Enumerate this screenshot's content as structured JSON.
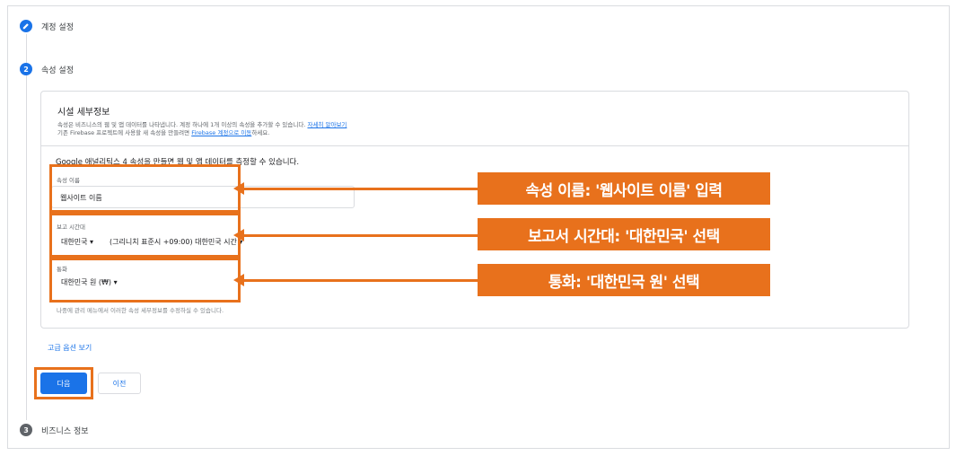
{
  "steps": [
    {
      "number": "",
      "label": "계정 설정",
      "icon": "pencil-icon"
    },
    {
      "number": "2",
      "label": "속성 설정"
    },
    {
      "number": "3",
      "label": "비즈니스 정보"
    }
  ],
  "card": {
    "title": "시설 세부정보",
    "sub1": "속성은 비즈니스의 웹 및 앱 데이터를 나타냅니다. 계정 하나에 1개 이상의 속성을 추가할 수 있습니다.",
    "sub1_link": "자세히 알아보기",
    "sub2_pre": "기존 Firebase 프로젝트에 사용할 새 속성을 만들려면 ",
    "sub2_link": "Firebase 계정으로 이동",
    "sub2_post": "하세요.",
    "intro": "Google 애널리틱스 4 속성을 만들면 웹 및 앱 데이터를 측정할 수 있습니다."
  },
  "fields": {
    "name_label": "속성 이름",
    "name_value": "웹사이트 이름",
    "tz_label": "보고 시간대",
    "tz_country": "대한민국 ▾",
    "tz_zone": "(그리니치 표준시 +09:00) 대한민국 시간 ▾",
    "currency_label": "통화",
    "currency_value": "대한민국 원 (₩) ▾",
    "footnote": "나중에 관리 메뉴에서 이러한 속성 세부정보를 수정하실 수 있습니다."
  },
  "advanced_link": "고급 옵션 보기",
  "buttons": {
    "next": "다음",
    "prev": "이전"
  },
  "callouts": [
    "속성 이름: '웹사이트 이름' 입력",
    "보고서 시간대: '대한민국' 선택",
    "통화: '대한민국 원' 선택"
  ],
  "colors": {
    "accent": "#1a73e8",
    "highlight": "#e8711c"
  }
}
